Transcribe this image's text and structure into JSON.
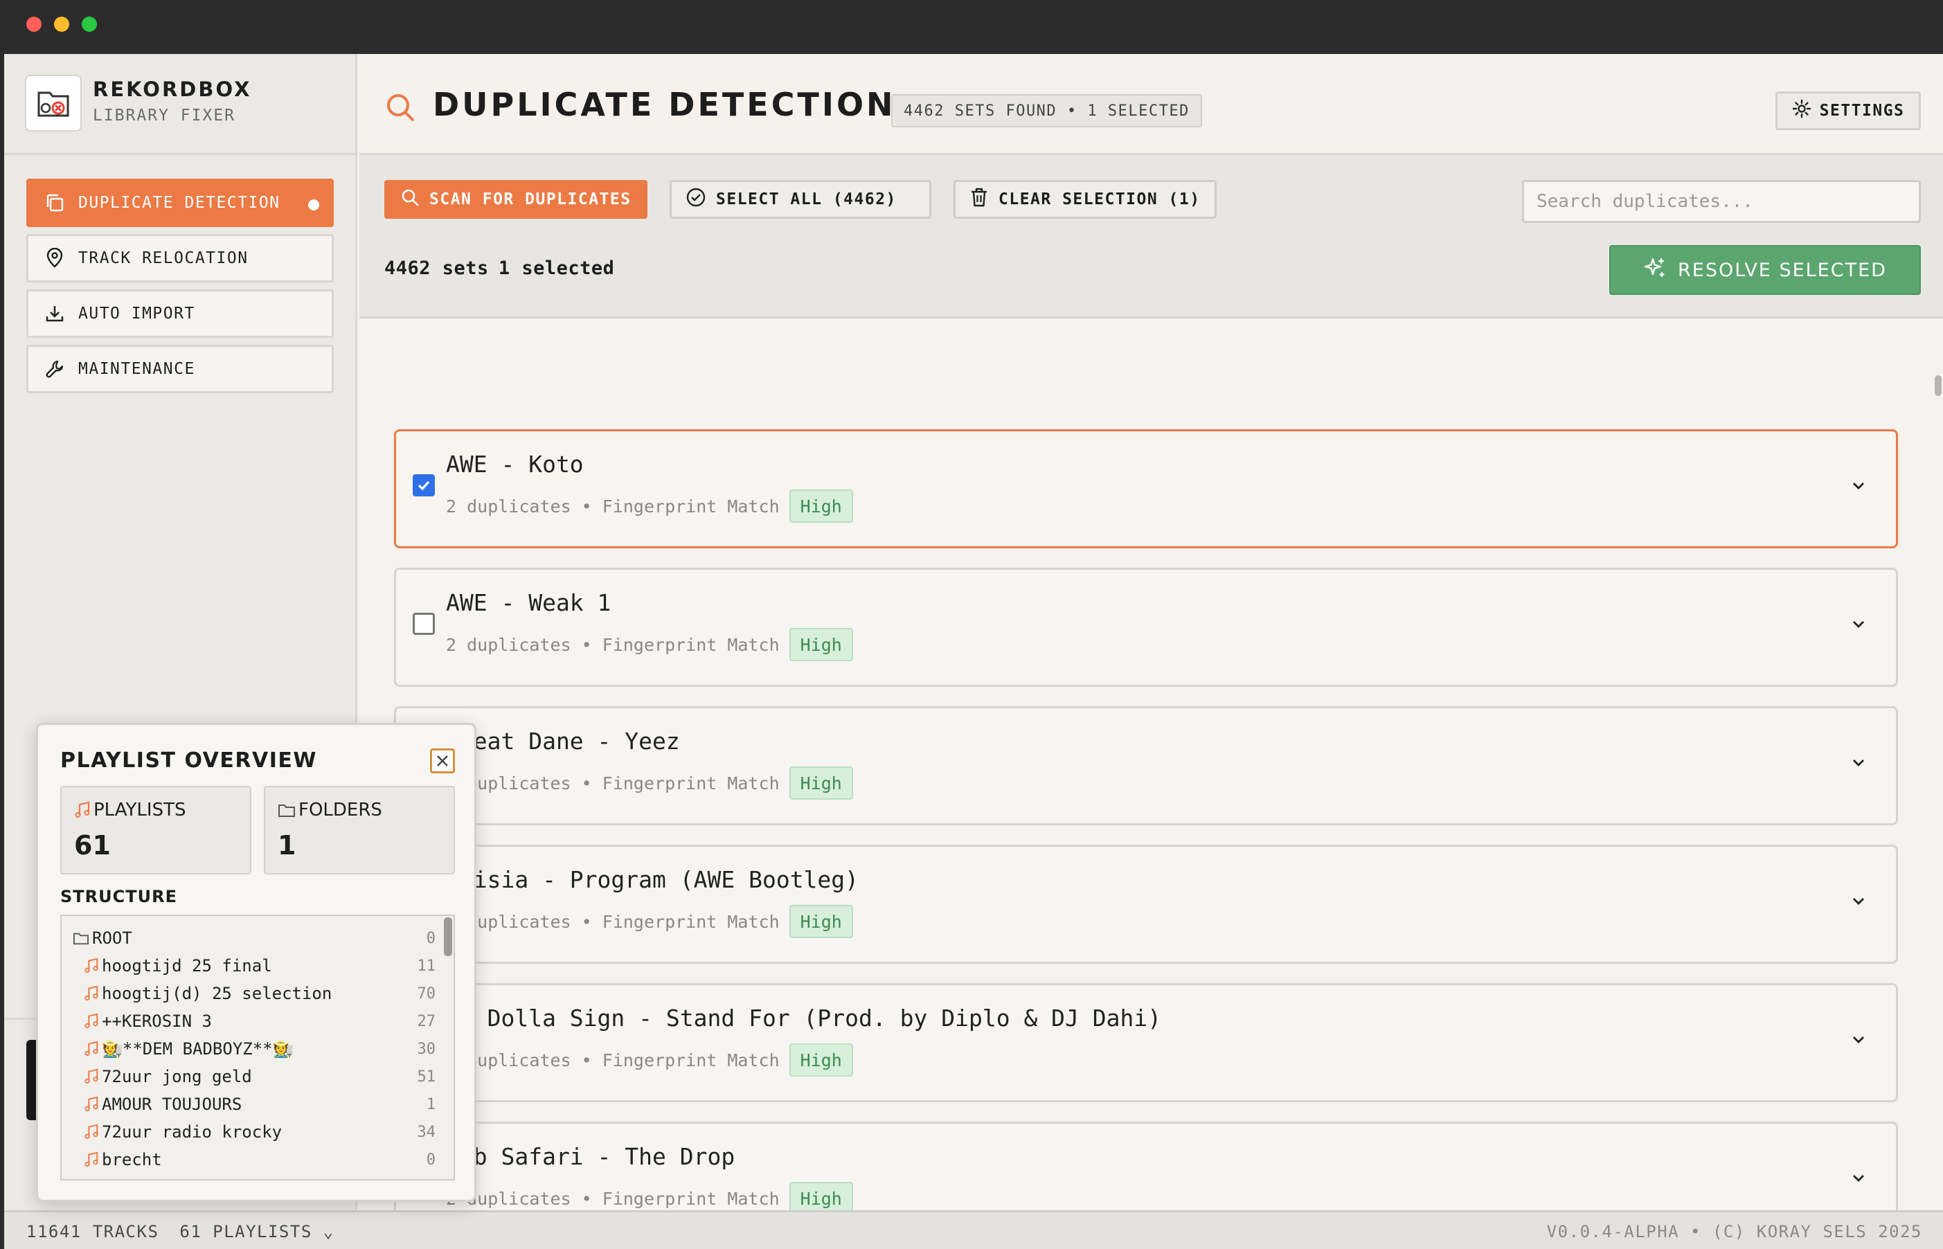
{
  "brand": {
    "title": "REKORDBOX",
    "subtitle": "LIBRARY FIXER"
  },
  "nav": {
    "items": [
      {
        "label": "DUPLICATE DETECTION",
        "icon": "copy-icon",
        "active": true
      },
      {
        "label": "TRACK RELOCATION",
        "icon": "map-pin-icon",
        "active": false
      },
      {
        "label": "AUTO IMPORT",
        "icon": "download-icon",
        "active": false
      },
      {
        "label": "MAINTENANCE",
        "icon": "wrench-icon",
        "active": false
      }
    ]
  },
  "header": {
    "title": "DUPLICATE DETECTION",
    "badge": "4462 SETS FOUND • 1 SELECTED",
    "settings_label": "SETTINGS"
  },
  "toolbar": {
    "scan_label": "SCAN FOR DUPLICATES",
    "select_all_label": "SELECT ALL (4462)",
    "clear_label": "CLEAR SELECTION (1)",
    "search_placeholder": "Search duplicates...",
    "sets_count": "4462 sets",
    "selected_count": "1 selected",
    "resolve_label": "RESOLVE SELECTED"
  },
  "duplicates": [
    {
      "title": "AWE - Koto",
      "meta": "2 duplicates • Fingerprint Match",
      "confidence": "High",
      "checked": true
    },
    {
      "title": "AWE - Weak 1",
      "meta": "2 duplicates • Fingerprint Match",
      "confidence": "High",
      "checked": false
    },
    {
      "title": "Great Dane - Yeez",
      "meta": "2 duplicates • Fingerprint Match",
      "confidence": "High",
      "checked": false
    },
    {
      "title": "Alisia - Program (AWE Bootleg)",
      "meta": "2 duplicates • Fingerprint Match",
      "confidence": "High",
      "checked": false
    },
    {
      "title": "Ty Dolla Sign - Stand For (Prod. by Diplo & DJ Dahi)",
      "meta": "2 duplicates • Fingerprint Match",
      "confidence": "High",
      "checked": false
    },
    {
      "title": "Dub Safari - The Drop",
      "meta": "2 duplicates • Fingerprint Match",
      "confidence": "High",
      "checked": false
    }
  ],
  "statusbar": {
    "tracks": "11641 TRACKS",
    "playlists": "61 PLAYLISTS",
    "version": "V0.0.4-ALPHA • (C) KORAY SELS 2025"
  },
  "playlist_overview": {
    "title": "PLAYLIST OVERVIEW",
    "playlists_label": "PLAYLISTS",
    "playlists_value": "61",
    "folders_label": "FOLDERS",
    "folders_value": "1",
    "structure_label": "STRUCTURE",
    "tree": [
      {
        "name": "ROOT",
        "count": "0",
        "type": "folder"
      },
      {
        "name": "hoogtijd 25 final",
        "count": "11",
        "type": "playlist"
      },
      {
        "name": "hoogtij(d) 25 selection",
        "count": "70",
        "type": "playlist"
      },
      {
        "name": "++KEROSIN 3",
        "count": "27",
        "type": "playlist"
      },
      {
        "name": "🧑‍🌾**DEM BADBOYZ**🧑‍🌾",
        "count": "30",
        "type": "playlist"
      },
      {
        "name": "72uur jong geld",
        "count": "51",
        "type": "playlist"
      },
      {
        "name": "AMOUR TOUJOURS",
        "count": "1",
        "type": "playlist"
      },
      {
        "name": "72uur radio krocky",
        "count": "34",
        "type": "playlist"
      },
      {
        "name": "brecht",
        "count": "0",
        "type": "playlist"
      }
    ]
  },
  "colors": {
    "accent": "#ec7a45",
    "success": "#5ba56e",
    "badge_high_bg": "#d8efdb",
    "badge_high_text": "#3a8c4e"
  }
}
